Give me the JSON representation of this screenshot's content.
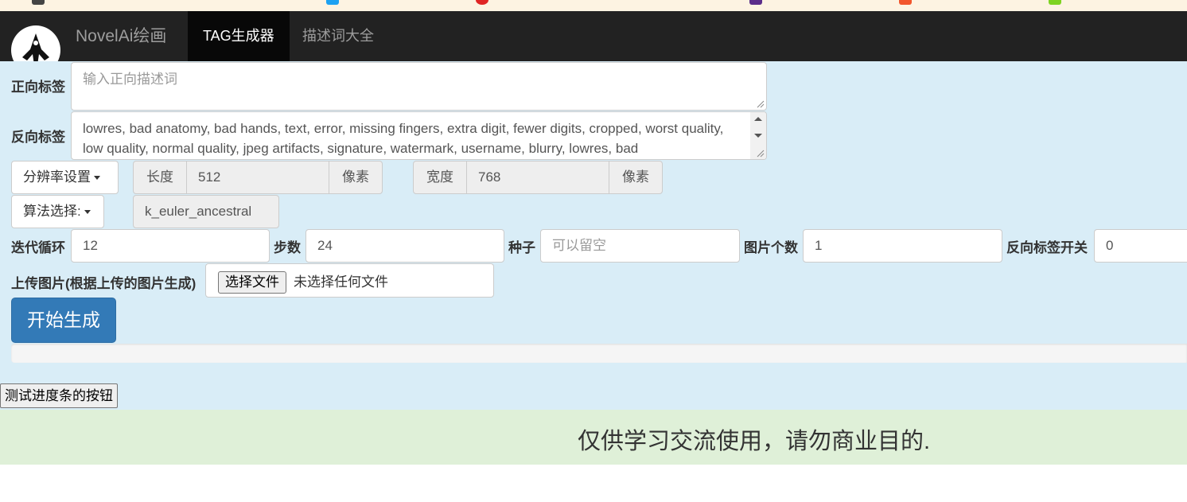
{
  "navbar": {
    "brand": "NovelAi绘画",
    "items": [
      {
        "label": "TAG生成器",
        "active": true
      },
      {
        "label": "描述词大全",
        "active": false
      }
    ]
  },
  "form": {
    "positive": {
      "label": "正向标签",
      "placeholder": "输入正向描述词",
      "value": ""
    },
    "negative": {
      "label": "反向标签",
      "value": "lowres, bad anatomy, bad hands, text, error, missing fingers, extra digit, fewer digits, cropped, worst quality, low quality, normal quality, jpeg artifacts, signature, watermark, username, blurry, lowres, bad"
    },
    "resolution": {
      "button": "分辨率设置",
      "length_label": "长度",
      "length_value": "512",
      "length_unit": "像素",
      "width_label": "宽度",
      "width_value": "768",
      "width_unit": "像素"
    },
    "sampler": {
      "button": "算法选择:",
      "value": "k_euler_ancestral"
    },
    "params": {
      "iterations": {
        "label": "迭代循环",
        "value": "12"
      },
      "steps": {
        "label": "步数",
        "value": "24"
      },
      "seed": {
        "label": "种子",
        "placeholder": "可以留空",
        "value": ""
      },
      "count": {
        "label": "图片个数",
        "value": "1"
      },
      "neg_switch": {
        "label": "反向标签开关",
        "value": "0"
      }
    },
    "upload": {
      "label": "上传图片(根据上传的图片生成)",
      "button": "选择文件",
      "status": "未选择任何文件"
    },
    "generate": "开始生成",
    "progress": 0
  },
  "test_button": "测试进度条的按钮",
  "footer": "仅供学习交流使用，请勿商业目的.",
  "colors": {
    "navbar": "#222222",
    "main_bg": "#d9edf7",
    "footer_bg": "#dff0d8",
    "primary": "#337ab7"
  }
}
